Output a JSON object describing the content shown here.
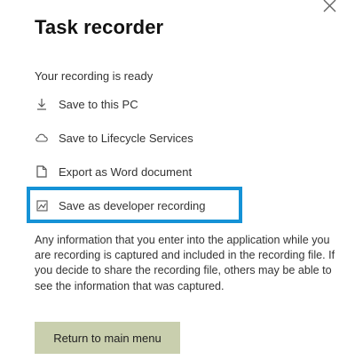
{
  "panel": {
    "title": "Task recorder",
    "status_text": "Your recording is ready"
  },
  "actions": [
    {
      "label": "Save to this PC",
      "icon": "download-icon"
    },
    {
      "label": "Save to Lifecycle Services",
      "icon": "cloud-icon"
    },
    {
      "label": "Export as Word document",
      "icon": "document-icon"
    },
    {
      "label": "Save as developer recording",
      "icon": "image-icon",
      "highlighted": true
    }
  ],
  "info_text": "Any information that you enter into the application while you are recording is captured and included in the recording file. If you decide to share the recording file, others may be able to see the information that was captured.",
  "return_button_label": "Return to main menu",
  "colors": {
    "highlight_border": "#1592d6",
    "button_background": "#c9cfae"
  }
}
